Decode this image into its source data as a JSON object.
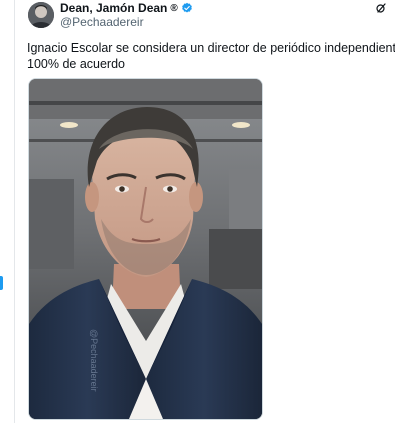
{
  "tweet": {
    "author": {
      "display_name": "Dean, Jamón Dean",
      "display_name_mark": "®",
      "handle": "@Pechaadereir",
      "verified": true,
      "avatar_icon": "user-avatar"
    },
    "text_lines": [
      "Ignacio Escolar se considera un director de periódico independiente.",
      "100% de acuerdo"
    ],
    "media": {
      "watermark": "@Pechaadereir",
      "kind": "photo"
    }
  },
  "colors": {
    "accent": "#1d9bf0",
    "text": "#0f1419",
    "muted": "#536471"
  }
}
